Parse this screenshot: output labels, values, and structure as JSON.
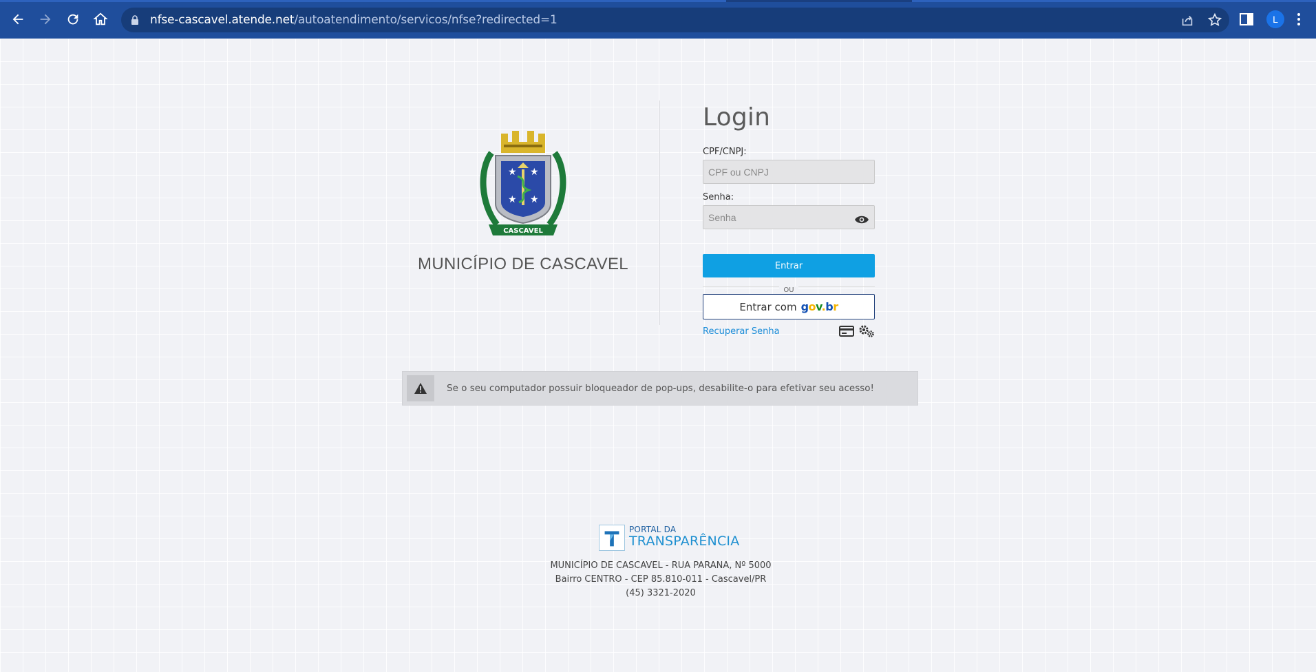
{
  "browser": {
    "url_domain": "nfse-cascavel.atende.net",
    "url_path": "/autoatendimento/servicos/nfse?redirected=1",
    "profile_initial": "L",
    "icons": [
      "back-icon",
      "forward-icon",
      "reload-icon",
      "home-icon",
      "lock-icon",
      "share-icon",
      "star-icon",
      "sidepanel-icon",
      "kebab-menu-icon"
    ]
  },
  "brand": {
    "municipality": "MUNICÍPIO DE CASCAVEL",
    "crest_banner": "CASCAVEL"
  },
  "login": {
    "title": "Login",
    "cpf_label": "CPF/CNPJ:",
    "cpf_placeholder": "CPF ou CNPJ",
    "cpf_value": "",
    "senha_label": "Senha:",
    "senha_placeholder": "Senha",
    "senha_value": "",
    "entrar_label": "Entrar",
    "ou_label": "OU",
    "gov_prefix": "Entrar com",
    "gov_logo": {
      "g": "g",
      "o": "o",
      "v": "v",
      "dot": ".",
      "b": "b",
      "r": "r"
    },
    "recuperar_label": "Recuperar Senha"
  },
  "alert": {
    "message": "Se o seu computador possuir bloqueador de pop-ups, desabilite-o para efetivar seu acesso!"
  },
  "footer": {
    "portal_line1": "PORTAL DA",
    "portal_line2": "TRANSPARÊNCIA",
    "address_line1": "MUNICÍPIO DE CASCAVEL - RUA PARANA, Nº 5000",
    "address_line2": "Bairro CENTRO - CEP 85.810-011 - Cascavel/PR",
    "phone": "(45) 3321-2020"
  },
  "colors": {
    "chrome": "#1f4e9c",
    "primary_button": "#0fa0e3",
    "gov_border": "#1f3f7a",
    "link": "#1a8cd8"
  }
}
